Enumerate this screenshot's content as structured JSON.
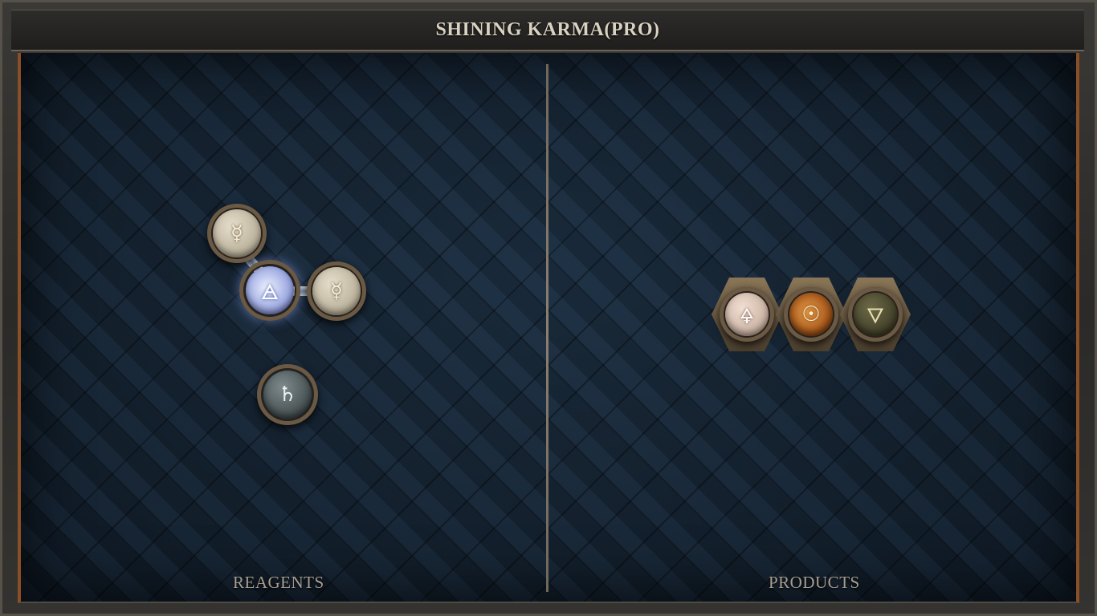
{
  "title": "SHINING KARMA(PRO)",
  "labels": {
    "reagents": "REAGENTS",
    "products": "PRODUCTS"
  },
  "reagents": {
    "molecules": [
      {
        "atoms": [
          {
            "symbol": "☿",
            "name": "mercury"
          },
          {
            "symbol": "🜁",
            "name": "air"
          },
          {
            "symbol": "☿",
            "name": "mercury"
          }
        ]
      },
      {
        "atoms": [
          {
            "symbol": "♄",
            "name": "saturn"
          }
        ]
      }
    ]
  },
  "products": {
    "molecules": [
      {
        "atoms": [
          {
            "symbol": "🜍",
            "name": "sulfur-like-up"
          },
          {
            "symbol": "☉",
            "name": "sun"
          },
          {
            "symbol": "🜄",
            "name": "water-like-down"
          }
        ]
      }
    ]
  },
  "colors": {
    "board": "#142231",
    "frame_accent": "#8a4f26",
    "label": "#a89f91",
    "title": "#d9d1c1"
  }
}
